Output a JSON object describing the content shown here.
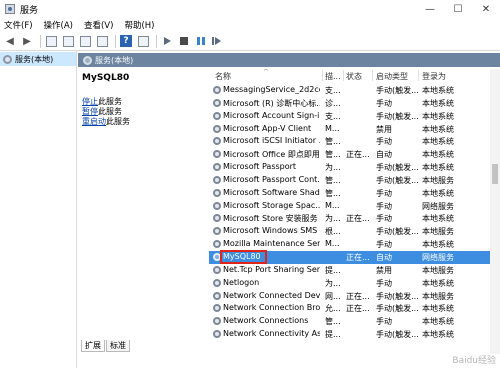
{
  "window": {
    "title": "服务",
    "minimize": "—",
    "maximize": "☐",
    "close": "✕"
  },
  "menu": [
    "文件(F)",
    "操作(A)",
    "查看(V)",
    "帮助(H)"
  ],
  "toolbar": {
    "help_label": "?"
  },
  "tree": {
    "root": "服务(本地)"
  },
  "panel": {
    "header": "服务(本地)"
  },
  "detail": {
    "service_name": "MySQL80",
    "links": [
      {
        "link": "停止",
        "text": "此服务"
      },
      {
        "link": "暂停",
        "text": "此服务"
      },
      {
        "link": "重启动",
        "text": "此服务"
      }
    ]
  },
  "columns": [
    "名称",
    "描...",
    "状态",
    "启动类型",
    "登录为"
  ],
  "rows": [
    {
      "name": "MessagingService_2d2cc...",
      "desc": "支...",
      "status": "",
      "startup": "手动(触发...",
      "logon": "本地系统"
    },
    {
      "name": "Microsoft (R) 诊断中心标...",
      "desc": "诊...",
      "status": "",
      "startup": "手动",
      "logon": "本地系统"
    },
    {
      "name": "Microsoft Account Sign-i...",
      "desc": "支...",
      "status": "",
      "startup": "手动(触发...",
      "logon": "本地系统"
    },
    {
      "name": "Microsoft App-V Client",
      "desc": "M...",
      "status": "",
      "startup": "禁用",
      "logon": "本地系统"
    },
    {
      "name": "Microsoft iSCSI Initiator ...",
      "desc": "管...",
      "status": "",
      "startup": "手动",
      "logon": "本地系统"
    },
    {
      "name": "Microsoft Office 即点即用...",
      "desc": "管...",
      "status": "正在...",
      "startup": "自动",
      "logon": "本地系统"
    },
    {
      "name": "Microsoft Passport",
      "desc": "为...",
      "status": "",
      "startup": "手动(触发...",
      "logon": "本地系统"
    },
    {
      "name": "Microsoft Passport Cont...",
      "desc": "管...",
      "status": "",
      "startup": "手动(触发...",
      "logon": "本地服务"
    },
    {
      "name": "Microsoft Software Shad...",
      "desc": "管...",
      "status": "",
      "startup": "手动",
      "logon": "本地系统"
    },
    {
      "name": "Microsoft Storage Spac...",
      "desc": "M...",
      "status": "",
      "startup": "手动",
      "logon": "网络服务"
    },
    {
      "name": "Microsoft Store 安装服务",
      "desc": "为...",
      "status": "正在...",
      "startup": "手动",
      "logon": "本地系统"
    },
    {
      "name": "Microsoft Windows SMS ...",
      "desc": "根...",
      "status": "",
      "startup": "手动(触发...",
      "logon": "本地服务"
    },
    {
      "name": "Mozilla Maintenance Ser...",
      "desc": "M...",
      "status": "",
      "startup": "手动",
      "logon": "本地系统"
    },
    {
      "name": "MySQL80",
      "desc": "",
      "status": "正在...",
      "startup": "自动",
      "logon": "网络服务",
      "selected": true
    },
    {
      "name": "Net.Tcp Port Sharing Ser...",
      "desc": "提...",
      "status": "",
      "startup": "禁用",
      "logon": "本地服务"
    },
    {
      "name": "Netlogon",
      "desc": "为...",
      "status": "",
      "startup": "手动",
      "logon": "本地系统"
    },
    {
      "name": "Network Connected Devi...",
      "desc": "网...",
      "status": "正在...",
      "startup": "手动(触发...",
      "logon": "本地服务"
    },
    {
      "name": "Network Connection Bro...",
      "desc": "允...",
      "status": "正在...",
      "startup": "手动(触发...",
      "logon": "本地系统"
    },
    {
      "name": "Network Connections",
      "desc": "管...",
      "status": "",
      "startup": "手动",
      "logon": "本地系统"
    },
    {
      "name": "Network Connectivity Ass...",
      "desc": "提...",
      "status": "",
      "startup": "手动(触发...",
      "logon": "本地系统"
    }
  ],
  "tabs": [
    "扩展",
    "标准"
  ],
  "watermark": "Baidu经验"
}
